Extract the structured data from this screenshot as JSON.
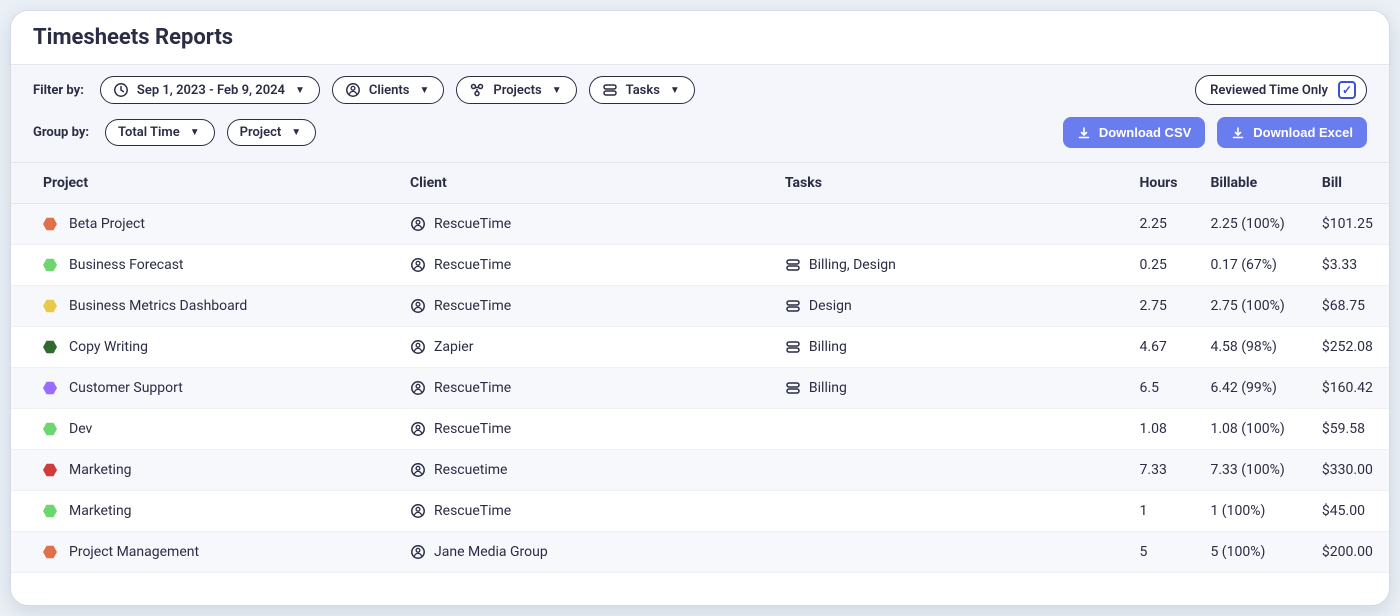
{
  "header": {
    "title": "Timesheets Reports"
  },
  "filters": {
    "label": "Filter by:",
    "dateRange": "Sep 1, 2023 - Feb 9, 2024",
    "clients": "Clients",
    "projects": "Projects",
    "tasks": "Tasks",
    "reviewedOnly": {
      "label": "Reviewed Time Only",
      "checked": true
    }
  },
  "group": {
    "label": "Group by:",
    "totalTime": "Total Time",
    "project": "Project"
  },
  "actions": {
    "downloadCsv": "Download CSV",
    "downloadExcel": "Download Excel"
  },
  "columns": {
    "project": "Project",
    "client": "Client",
    "tasks": "Tasks",
    "hours": "Hours",
    "billable": "Billable",
    "bill": "Bill"
  },
  "rows": [
    {
      "color": "#e0714a",
      "project": "Beta Project",
      "client": "RescueTime",
      "tasks": "",
      "hours": "2.25",
      "billable": "2.25 (100%)",
      "bill": "$101.25"
    },
    {
      "color": "#6ed66e",
      "project": "Business Forecast",
      "client": "RescueTime",
      "tasks": "Billing, Design",
      "hours": "0.25",
      "billable": "0.17 (67%)",
      "bill": "$3.33"
    },
    {
      "color": "#e8c94a",
      "project": "Business Metrics Dashboard",
      "client": "RescueTime",
      "tasks": "Design",
      "hours": "2.75",
      "billable": "2.75 (100%)",
      "bill": "$68.75"
    },
    {
      "color": "#2f6b2f",
      "project": "Copy Writing",
      "client": "Zapier",
      "tasks": "Billing",
      "hours": "4.67",
      "billable": "4.58 (98%)",
      "bill": "$252.08"
    },
    {
      "color": "#9a6bff",
      "project": "Customer Support",
      "client": "RescueTime",
      "tasks": "Billing",
      "hours": "6.5",
      "billable": "6.42 (99%)",
      "bill": "$160.42"
    },
    {
      "color": "#6ed66e",
      "project": "Dev",
      "client": "RescueTime",
      "tasks": "",
      "hours": "1.08",
      "billable": "1.08 (100%)",
      "bill": "$59.58"
    },
    {
      "color": "#d13b3b",
      "project": "Marketing",
      "client": "Rescuetime",
      "tasks": "",
      "hours": "7.33",
      "billable": "7.33 (100%)",
      "bill": "$330.00"
    },
    {
      "color": "#6ed66e",
      "project": "Marketing",
      "client": "RescueTime",
      "tasks": "",
      "hours": "1",
      "billable": "1 (100%)",
      "bill": "$45.00"
    },
    {
      "color": "#e0714a",
      "project": "Project Management",
      "client": "Jane Media Group",
      "tasks": "",
      "hours": "5",
      "billable": "5 (100%)",
      "bill": "$200.00"
    }
  ]
}
